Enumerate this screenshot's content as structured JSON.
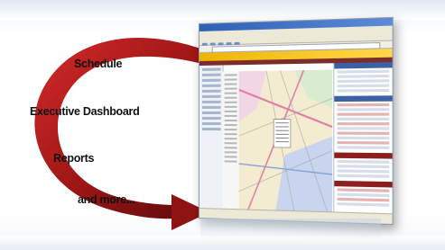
{
  "features": [
    "Schedule",
    "Executive Dashboard",
    "Reports",
    "and more..."
  ],
  "colors": {
    "arrow": "#b01e1e",
    "arrow_dark": "#5a0b0b",
    "browser_title": "#2f5fb3",
    "banner": "#f0b400",
    "nav": "#7b2c2c"
  },
  "icons": [
    "curved-arrow-icon"
  ]
}
